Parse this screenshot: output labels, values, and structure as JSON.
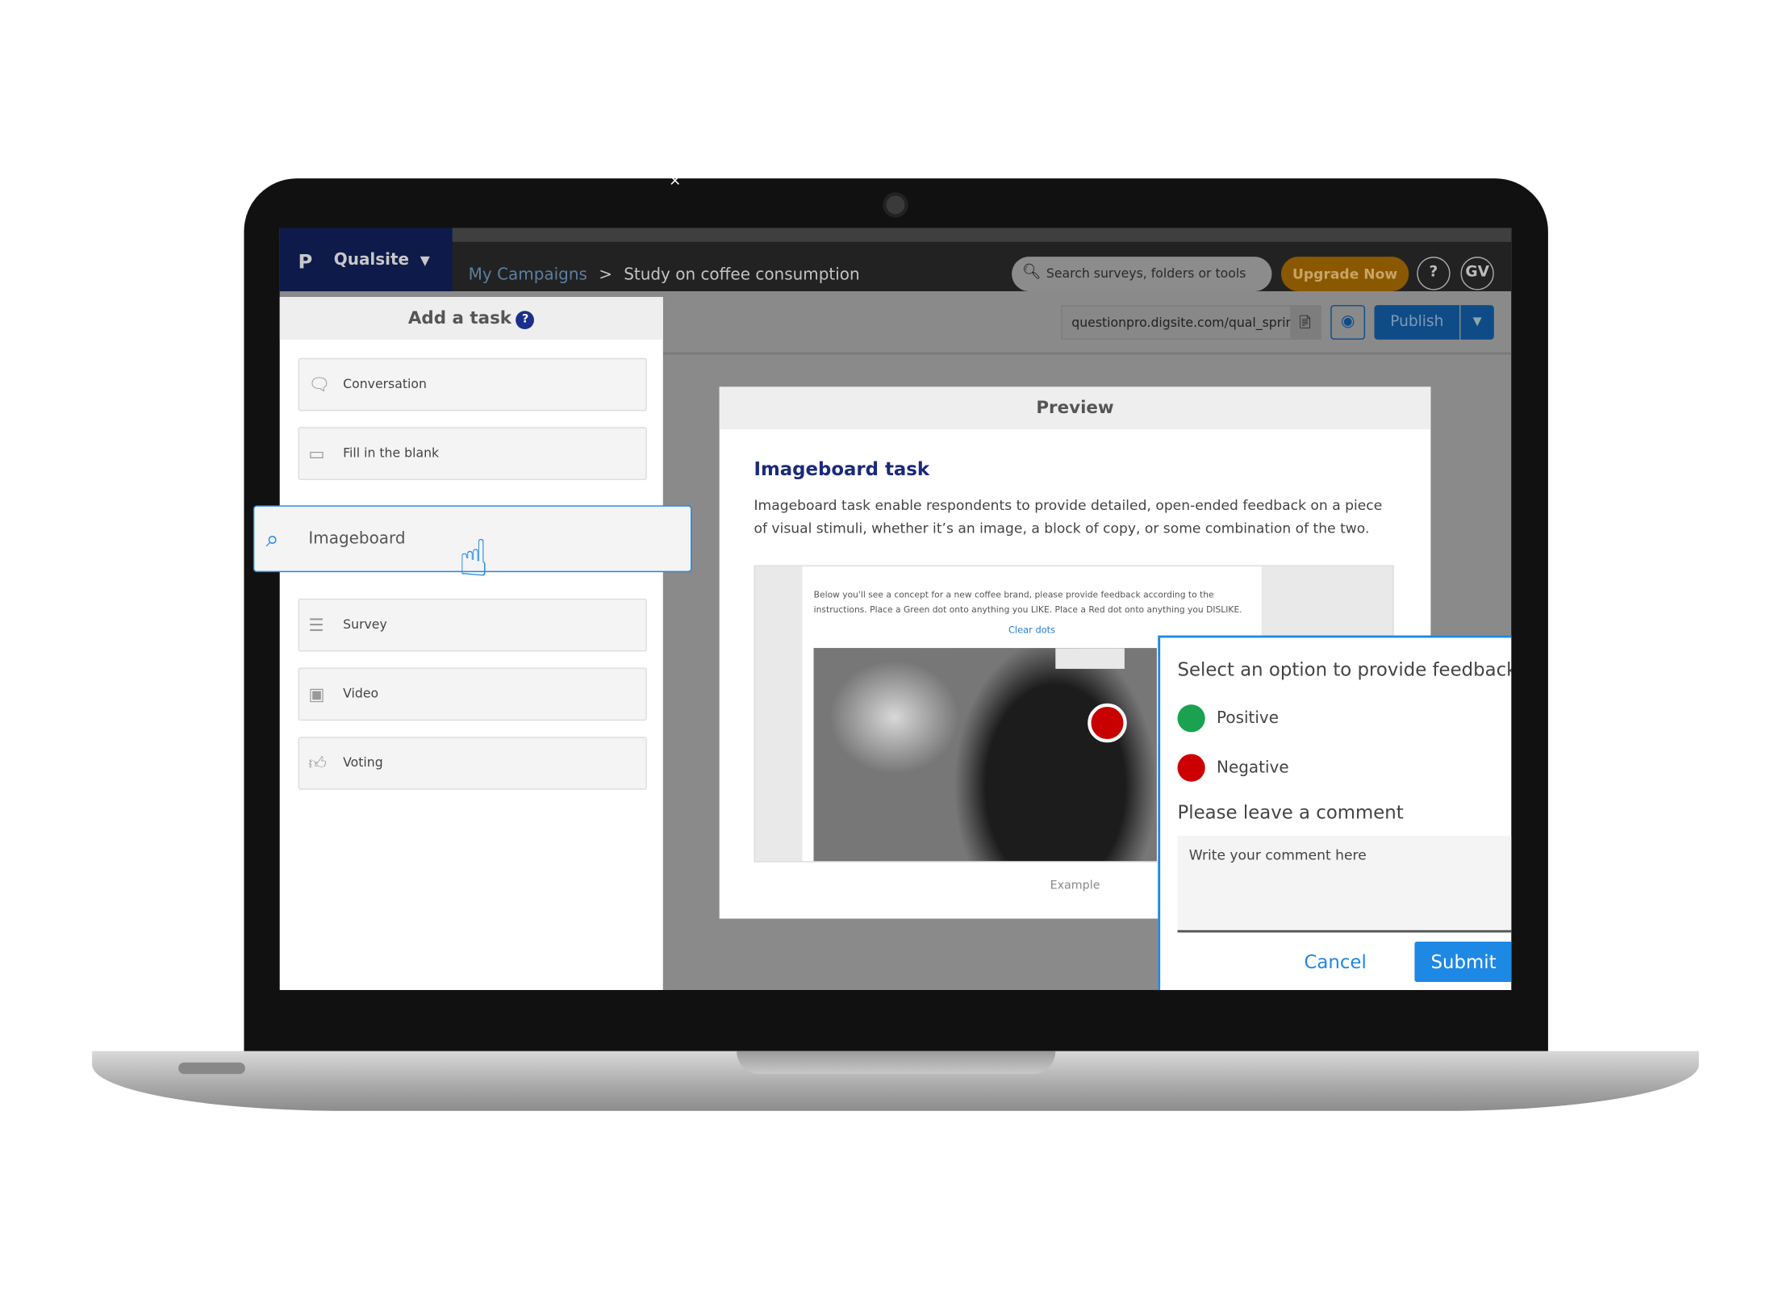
{
  "app": {
    "logo": "P",
    "name": "Qualsite"
  },
  "breadcrumb": {
    "items": [
      "My Campaigns",
      "Study on coffee consumption"
    ],
    "separator": ">"
  },
  "search": {
    "placeholder": "Search surveys, folders or tools"
  },
  "header_actions": {
    "upgrade": "Upgrade Now",
    "help": "?",
    "avatar": "GV"
  },
  "toolbar": {
    "url": "questionpro.digsite.com/qual_sprint",
    "publish": "Publish"
  },
  "left_panel": {
    "title": "Add a task",
    "help": "?",
    "tasks": [
      {
        "label": "Conversation",
        "icon": "chat-bubbles-icon"
      },
      {
        "label": "Fill in the blank",
        "icon": "fill-blank-icon"
      },
      {
        "label": "Imageboard",
        "icon": "image-search-icon",
        "active": true
      },
      {
        "label": "Survey",
        "icon": "survey-list-icon"
      },
      {
        "label": "Video",
        "icon": "video-person-icon"
      },
      {
        "label": "Voting",
        "icon": "thumbs-icon"
      }
    ]
  },
  "preview": {
    "header": "Preview",
    "title": "Imageboard task",
    "description": "Imageboard task enable respondents to provide detailed, open-ended feedback on a piece of visual stimuli, whether it’s an image, a block of copy, or some combination of the two.",
    "instructions": "Below you'll see a concept for a new coffee brand, please provide feedback according to the instructions. Place a Green dot onto anything you LIKE. Place a Red dot onto anything you DISLIKE.",
    "clear_dots": "Clear dots",
    "caption": "Example"
  },
  "feedback_popup": {
    "prompt": "Select an option to provide feedback",
    "options": [
      {
        "label": "Positive",
        "color": "#1aa251"
      },
      {
        "label": "Negative",
        "color": "#cc0000"
      }
    ],
    "comment_label": "Please leave a comment",
    "comment_placeholder": "Write your comment here",
    "cancel": "Cancel",
    "submit": "Submit"
  },
  "window": {
    "close": "×"
  },
  "colors": {
    "accent": "#1e88e5",
    "brand_navy": "#1b2a7a",
    "upgrade": "#8a5800",
    "publish": "#0f4c87"
  }
}
